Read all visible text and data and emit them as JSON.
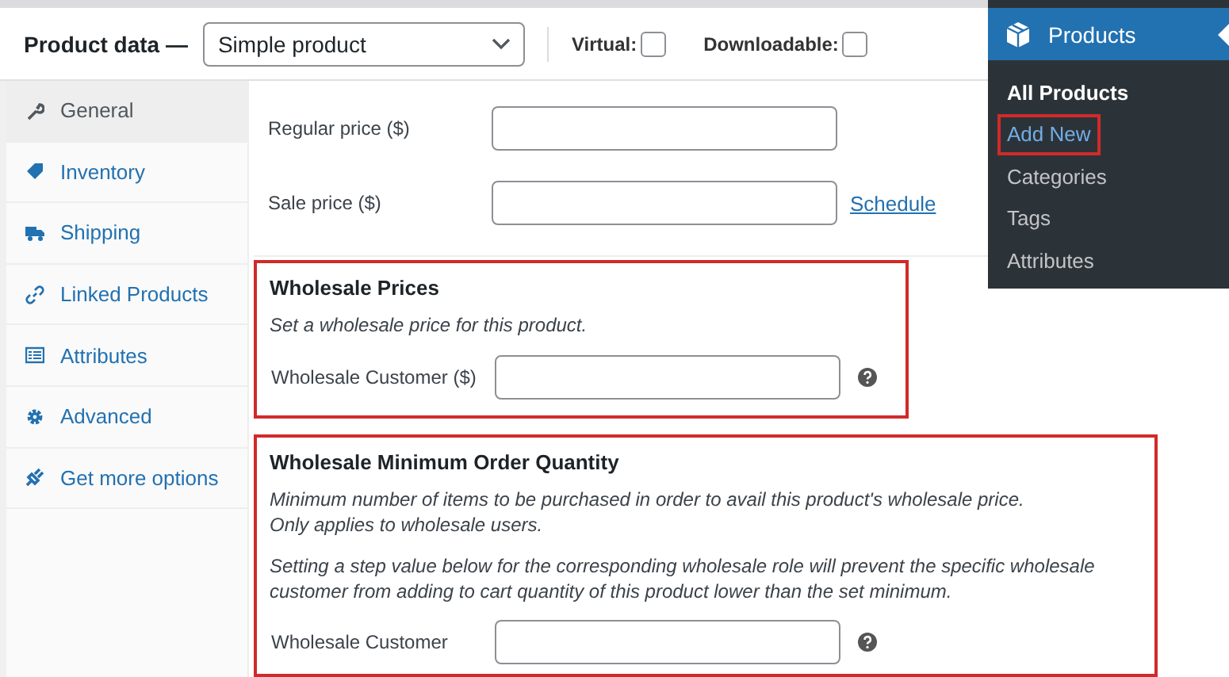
{
  "header": {
    "title": "Product data —",
    "product_type": "Simple product",
    "options": [
      {
        "label": "Virtual:",
        "checked": false
      },
      {
        "label": "Downloadable:",
        "checked": false
      }
    ]
  },
  "tabs": [
    {
      "label": "General",
      "selected": true
    },
    {
      "label": "Inventory",
      "selected": false
    },
    {
      "label": "Shipping",
      "selected": false
    },
    {
      "label": "Linked Products",
      "selected": false
    },
    {
      "label": "Attributes",
      "selected": false
    },
    {
      "label": "Advanced",
      "selected": false
    },
    {
      "label": "Get more options",
      "selected": false
    }
  ],
  "price_fields": [
    {
      "label": "Regular price ($)"
    },
    {
      "label": "Sale price ($)",
      "link": "Schedule"
    }
  ],
  "sections": [
    {
      "title": "Wholesale Prices",
      "highlighted": true,
      "paragraphs": [
        [
          "Set a wholesale price for this product."
        ]
      ],
      "field_label": "Wholesale Customer ($)"
    },
    {
      "title": "Wholesale Minimum Order Quantity",
      "highlighted": true,
      "paragraphs": [
        [
          "Minimum number of items to be purchased in order to avail this product's wholesale price.",
          "Only applies to wholesale users."
        ],
        [
          "Setting a step value below for the corresponding wholesale role will prevent the specific wholesale",
          "customer from adding to cart quantity of this product lower than the set minimum."
        ]
      ],
      "field_label": "Wholesale Customer"
    }
  ],
  "admin_menu": {
    "title": "Products",
    "items": [
      {
        "label": "All Products",
        "selected": true,
        "highlighted": false
      },
      {
        "label": "Add New",
        "selected": false,
        "highlighted": true
      },
      {
        "label": "Categories",
        "selected": false,
        "highlighted": false
      },
      {
        "label": "Tags",
        "selected": false,
        "highlighted": false
      },
      {
        "label": "Attributes",
        "selected": false,
        "highlighted": false
      }
    ]
  }
}
